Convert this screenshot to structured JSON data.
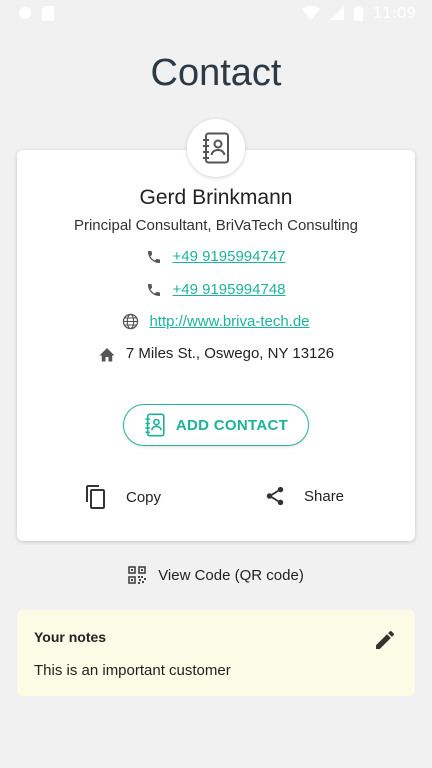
{
  "status_bar": {
    "time": "11:09"
  },
  "header": {
    "title": "Contact"
  },
  "contact": {
    "name": "Gerd Brinkmann",
    "job": "Principal Consultant, BriVaTech Consulting",
    "phone_1": "+49 9195994747",
    "phone_2": "+49 9195994748",
    "website": "http://www.briva-tech.de",
    "address": "7 Miles St., Oswego, NY 13126"
  },
  "actions": {
    "add_contact": "ADD CONTACT",
    "copy": "Copy",
    "share": "Share",
    "view_code": "View Code (QR code)"
  },
  "notes": {
    "title": "Your notes",
    "text": "This is an important customer"
  },
  "colors": {
    "accent": "#1db39a",
    "title": "#2b3a45",
    "background": "#f1f1f1",
    "notes_bg": "#fcfce6"
  },
  "icons": [
    "contact-book-icon",
    "phone-icon",
    "globe-icon",
    "home-icon",
    "copy-icon",
    "share-icon",
    "qr-code-icon",
    "pencil-icon"
  ]
}
